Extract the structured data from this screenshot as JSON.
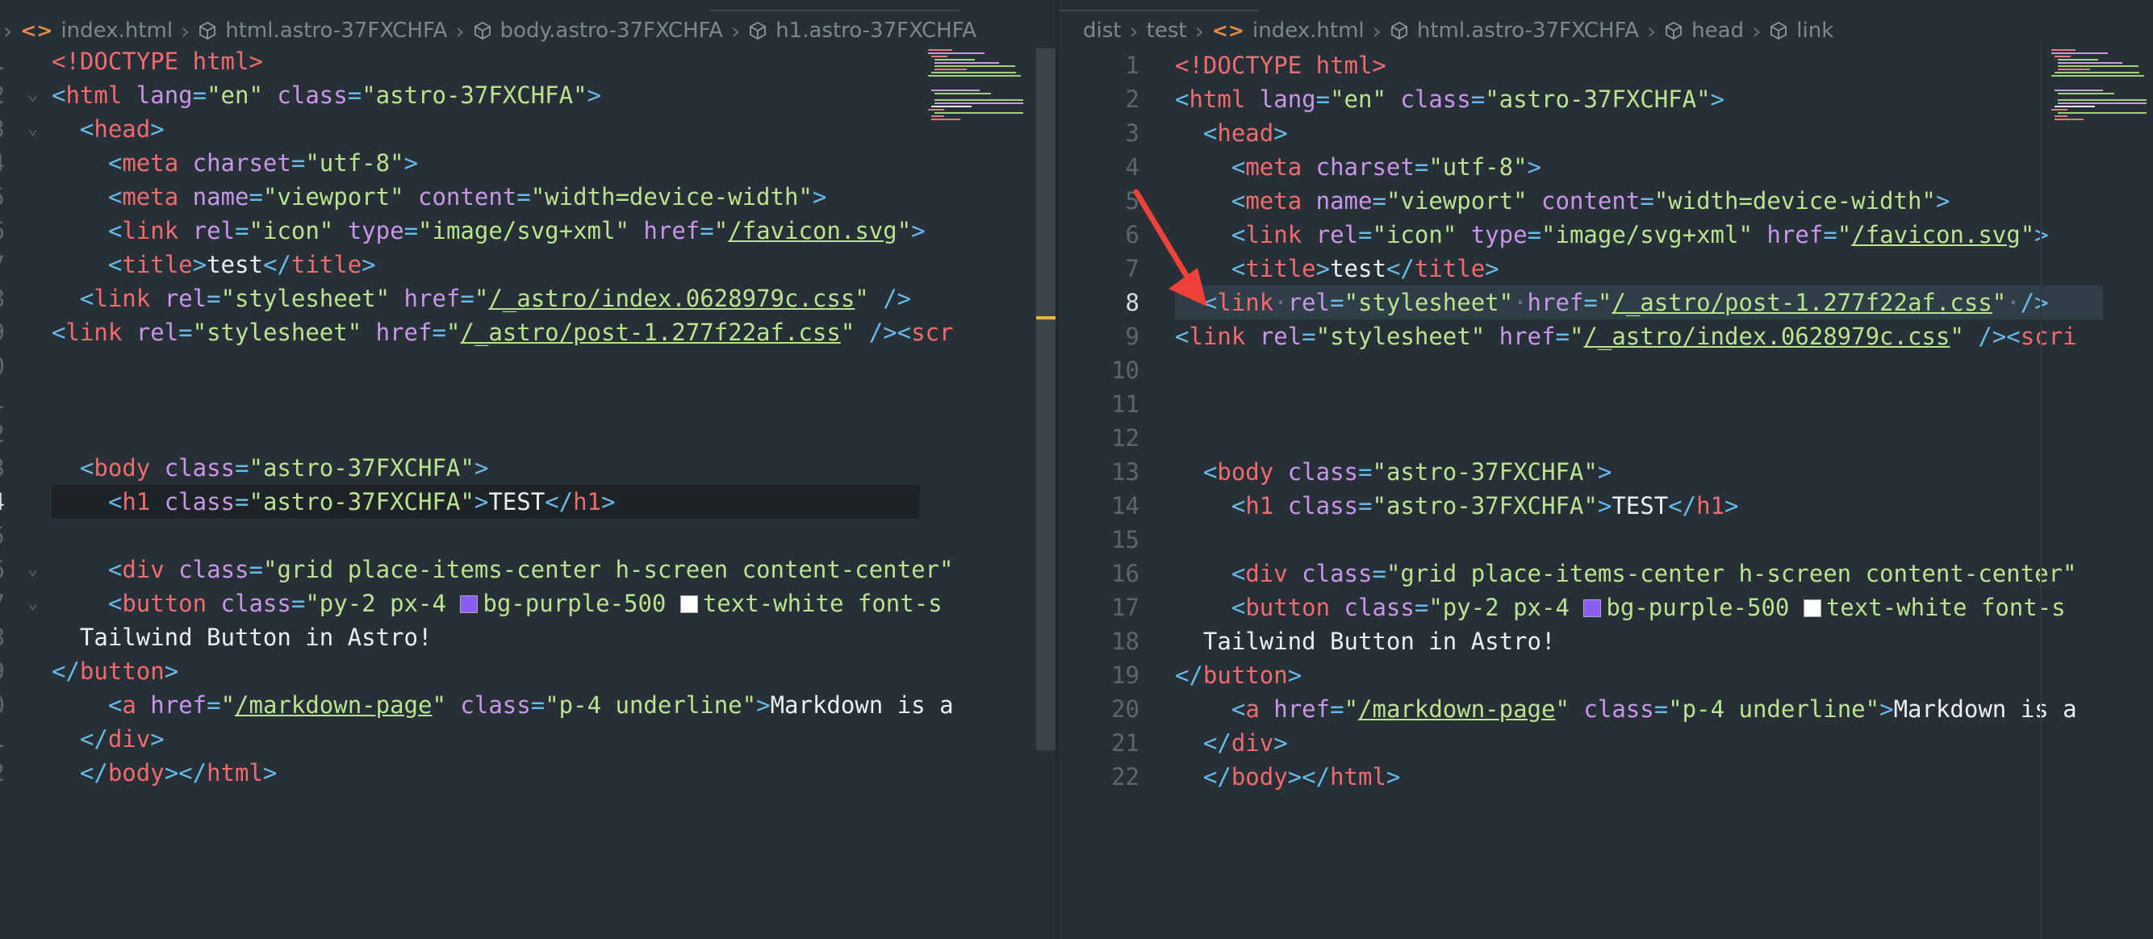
{
  "left": {
    "breadcrumbs": [
      {
        "icon": "html-tag-icon",
        "label": "index.html"
      },
      {
        "icon": "cube-icon",
        "label": "html.astro-37FXCHFA"
      },
      {
        "icon": "cube-icon",
        "label": "body.astro-37FXCHFA"
      },
      {
        "icon": "cube-icon",
        "label": "h1.astro-37FXCHFA"
      }
    ],
    "line_numbers": [
      "",
      "",
      "",
      "",
      "",
      "",
      "",
      "",
      "",
      "",
      "",
      "",
      "",
      "",
      "",
      "",
      "",
      "",
      "",
      "",
      "",
      ""
    ],
    "line_suffixes": [
      "1",
      "2",
      "3",
      "4",
      "5",
      "6",
      "7",
      "8",
      "9",
      "0",
      "1",
      "2",
      "3",
      "4",
      "5",
      "6",
      "7",
      "8",
      "9",
      "0",
      "1",
      "2"
    ],
    "current_line": 14,
    "fold_lines": [
      2,
      3,
      16,
      17
    ]
  },
  "right": {
    "breadcrumbs": [
      {
        "icon": "",
        "label": "dist"
      },
      {
        "icon": "",
        "label": "test"
      },
      {
        "icon": "html-tag-icon",
        "label": "index.html"
      },
      {
        "icon": "cube-icon",
        "label": "html.astro-37FXCHFA"
      },
      {
        "icon": "cube-icon",
        "label": "head"
      },
      {
        "icon": "cube-icon",
        "label": "link"
      }
    ],
    "line_numbers": [
      "1",
      "2",
      "3",
      "4",
      "5",
      "6",
      "7",
      "8",
      "9",
      "10",
      "11",
      "12",
      "13",
      "14",
      "15",
      "16",
      "17",
      "18",
      "19",
      "20",
      "21",
      "22"
    ],
    "current_line": 8
  },
  "code": {
    "doctype": "<!DOCTYPE html>",
    "html_open_tag": "html",
    "lang_attr": "lang",
    "lang_val": "\"en\"",
    "class_attr": "class",
    "class_val": "\"astro-37FXCHFA\"",
    "head": "head",
    "meta": "meta",
    "charset_attr": "charset",
    "charset_val": "\"utf-8\"",
    "name_attr": "name",
    "name_val": "\"viewport\"",
    "content_attr": "content",
    "content_val": "\"width=device-width\"",
    "link": "link",
    "rel_attr": "rel",
    "icon_val": "\"icon\"",
    "type_attr": "type",
    "type_val": "\"image/svg+xml\"",
    "href_attr": "href",
    "favicon": "/favicon.svg",
    "title": "title",
    "title_text": "test",
    "stylesheet_val": "\"stylesheet\"",
    "index_css": "/_astro/index.0628979c.css",
    "post_css": "/_astro/post-1.277f22af.css",
    "script_trunc_left": "scr",
    "script_trunc_right": "scri",
    "body": "body",
    "h1": "h1",
    "h1_text": "TEST",
    "div": "div",
    "div_class_val": "\"grid place-items-center h-screen content-center\"",
    "button": "button",
    "button_class_pre": "\"py-2 px-4 ",
    "bg_purple": "bg-purple-500 ",
    "text_white_left": "text-white font-s",
    "text_white_right": "text-white font-s",
    "button_text": "Tailwind Button in Astro!",
    "a": "a",
    "markdown_href": "/markdown-page",
    "a_class_val": "\"p-4 underline\"",
    "a_text_left": "Markdown is a",
    "a_text_right": "Markdown is a"
  },
  "colors": {
    "swatch_purple": "#8b5cf6",
    "swatch_white": "#ffffff",
    "arrow": "#f0403a"
  }
}
